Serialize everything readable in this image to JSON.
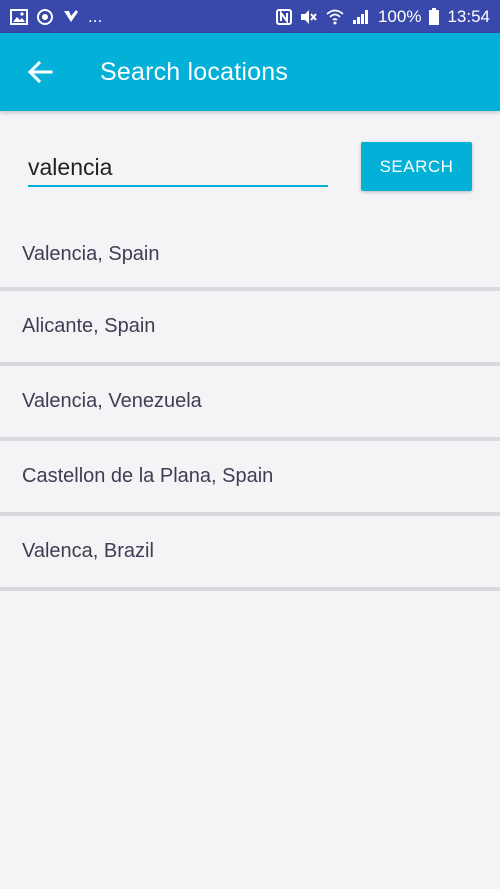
{
  "status_bar": {
    "left_icons": [
      "image-icon",
      "sync-icon",
      "check-icon"
    ],
    "more": "...",
    "battery": "100%",
    "time": "13:54"
  },
  "app_bar": {
    "back_icon": "arrow-back-icon",
    "title": "Search locations"
  },
  "search": {
    "value": "valencia",
    "button_label": "SEARCH"
  },
  "results": [
    {
      "label": "Valencia, Spain"
    },
    {
      "label": "Alicante, Spain"
    },
    {
      "label": "Valencia, Venezuela"
    },
    {
      "label": "Castellon de la Plana, Spain"
    },
    {
      "label": "Valenca, Brazil"
    }
  ],
  "colors": {
    "status_bar": "#3949ab",
    "accent": "#03b1d8",
    "background": "#f4f3f6",
    "divider": "#d9d8dc"
  }
}
